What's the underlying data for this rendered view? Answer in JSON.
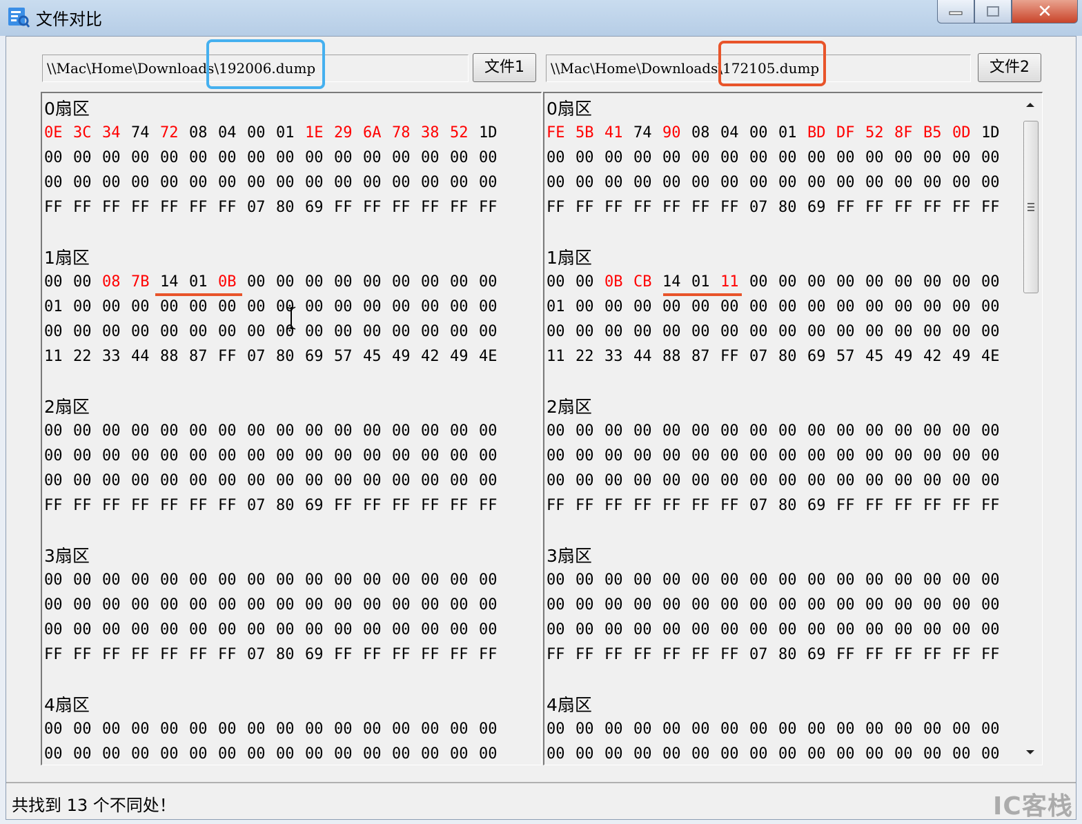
{
  "window": {
    "title": "文件对比",
    "controls": [
      "minimize",
      "maximize",
      "close"
    ],
    "close_glyph": "✕"
  },
  "left": {
    "path": "\\\\Mac\\Home\\Downloads\\192006.dump",
    "button_label": "文件1",
    "sectors": [
      {
        "title": "0扇区",
        "rows": [
          [
            "0E",
            "3C",
            "34",
            "74",
            "72",
            "08",
            "04",
            "00",
            "01",
            "1E",
            "29",
            "6A",
            "78",
            "38",
            "52",
            "1D"
          ],
          [
            "00",
            "00",
            "00",
            "00",
            "00",
            "00",
            "00",
            "00",
            "00",
            "00",
            "00",
            "00",
            "00",
            "00",
            "00",
            "00"
          ],
          [
            "00",
            "00",
            "00",
            "00",
            "00",
            "00",
            "00",
            "00",
            "00",
            "00",
            "00",
            "00",
            "00",
            "00",
            "00",
            "00"
          ],
          [
            "FF",
            "FF",
            "FF",
            "FF",
            "FF",
            "FF",
            "FF",
            "07",
            "80",
            "69",
            "FF",
            "FF",
            "FF",
            "FF",
            "FF",
            "FF"
          ]
        ],
        "diff": [
          [
            0,
            1,
            2,
            4,
            9,
            10,
            11,
            12,
            13,
            14
          ]
        ]
      },
      {
        "title": "1扇区",
        "rows": [
          [
            "00",
            "00",
            "08",
            "7B",
            "14",
            "01",
            "0B",
            "00",
            "00",
            "00",
            "00",
            "00",
            "00",
            "00",
            "00",
            "00"
          ],
          [
            "01",
            "00",
            "00",
            "00",
            "00",
            "00",
            "00",
            "00",
            "00",
            "00",
            "00",
            "00",
            "00",
            "00",
            "00",
            "00"
          ],
          [
            "00",
            "00",
            "00",
            "00",
            "00",
            "00",
            "00",
            "00",
            "00",
            "00",
            "00",
            "00",
            "00",
            "00",
            "00",
            "00"
          ],
          [
            "11",
            "22",
            "33",
            "44",
            "88",
            "87",
            "FF",
            "07",
            "80",
            "69",
            "57",
            "45",
            "49",
            "42",
            "49",
            "4E"
          ]
        ],
        "diff": [
          [
            2,
            3,
            6
          ]
        ]
      },
      {
        "title": "2扇区",
        "rows": [
          [
            "00",
            "00",
            "00",
            "00",
            "00",
            "00",
            "00",
            "00",
            "00",
            "00",
            "00",
            "00",
            "00",
            "00",
            "00",
            "00"
          ],
          [
            "00",
            "00",
            "00",
            "00",
            "00",
            "00",
            "00",
            "00",
            "00",
            "00",
            "00",
            "00",
            "00",
            "00",
            "00",
            "00"
          ],
          [
            "00",
            "00",
            "00",
            "00",
            "00",
            "00",
            "00",
            "00",
            "00",
            "00",
            "00",
            "00",
            "00",
            "00",
            "00",
            "00"
          ],
          [
            "FF",
            "FF",
            "FF",
            "FF",
            "FF",
            "FF",
            "FF",
            "07",
            "80",
            "69",
            "FF",
            "FF",
            "FF",
            "FF",
            "FF",
            "FF"
          ]
        ],
        "diff": []
      },
      {
        "title": "3扇区",
        "rows": [
          [
            "00",
            "00",
            "00",
            "00",
            "00",
            "00",
            "00",
            "00",
            "00",
            "00",
            "00",
            "00",
            "00",
            "00",
            "00",
            "00"
          ],
          [
            "00",
            "00",
            "00",
            "00",
            "00",
            "00",
            "00",
            "00",
            "00",
            "00",
            "00",
            "00",
            "00",
            "00",
            "00",
            "00"
          ],
          [
            "00",
            "00",
            "00",
            "00",
            "00",
            "00",
            "00",
            "00",
            "00",
            "00",
            "00",
            "00",
            "00",
            "00",
            "00",
            "00"
          ],
          [
            "FF",
            "FF",
            "FF",
            "FF",
            "FF",
            "FF",
            "FF",
            "07",
            "80",
            "69",
            "FF",
            "FF",
            "FF",
            "FF",
            "FF",
            "FF"
          ]
        ],
        "diff": []
      },
      {
        "title": "4扇区",
        "rows": [
          [
            "00",
            "00",
            "00",
            "00",
            "00",
            "00",
            "00",
            "00",
            "00",
            "00",
            "00",
            "00",
            "00",
            "00",
            "00",
            "00"
          ],
          [
            "00",
            "00",
            "00",
            "00",
            "00",
            "00",
            "00",
            "00",
            "00",
            "00",
            "00",
            "00",
            "00",
            "00",
            "00",
            "00"
          ]
        ],
        "diff": []
      }
    ]
  },
  "right": {
    "path": "\\\\Mac\\Home\\Downloads\\172105.dump",
    "button_label": "文件2",
    "sectors": [
      {
        "title": "0扇区",
        "rows": [
          [
            "FE",
            "5B",
            "41",
            "74",
            "90",
            "08",
            "04",
            "00",
            "01",
            "BD",
            "DF",
            "52",
            "8F",
            "B5",
            "0D",
            "1D"
          ],
          [
            "00",
            "00",
            "00",
            "00",
            "00",
            "00",
            "00",
            "00",
            "00",
            "00",
            "00",
            "00",
            "00",
            "00",
            "00",
            "00"
          ],
          [
            "00",
            "00",
            "00",
            "00",
            "00",
            "00",
            "00",
            "00",
            "00",
            "00",
            "00",
            "00",
            "00",
            "00",
            "00",
            "00"
          ],
          [
            "FF",
            "FF",
            "FF",
            "FF",
            "FF",
            "FF",
            "FF",
            "07",
            "80",
            "69",
            "FF",
            "FF",
            "FF",
            "FF",
            "FF",
            "FF"
          ]
        ],
        "diff": [
          [
            0,
            1,
            2,
            4,
            9,
            10,
            11,
            12,
            13,
            14
          ]
        ]
      },
      {
        "title": "1扇区",
        "rows": [
          [
            "00",
            "00",
            "0B",
            "CB",
            "14",
            "01",
            "11",
            "00",
            "00",
            "00",
            "00",
            "00",
            "00",
            "00",
            "00",
            "00"
          ],
          [
            "01",
            "00",
            "00",
            "00",
            "00",
            "00",
            "00",
            "00",
            "00",
            "00",
            "00",
            "00",
            "00",
            "00",
            "00",
            "00"
          ],
          [
            "00",
            "00",
            "00",
            "00",
            "00",
            "00",
            "00",
            "00",
            "00",
            "00",
            "00",
            "00",
            "00",
            "00",
            "00",
            "00"
          ],
          [
            "11",
            "22",
            "33",
            "44",
            "88",
            "87",
            "FF",
            "07",
            "80",
            "69",
            "57",
            "45",
            "49",
            "42",
            "49",
            "4E"
          ]
        ],
        "diff": [
          [
            2,
            3,
            6
          ]
        ]
      },
      {
        "title": "2扇区",
        "rows": [
          [
            "00",
            "00",
            "00",
            "00",
            "00",
            "00",
            "00",
            "00",
            "00",
            "00",
            "00",
            "00",
            "00",
            "00",
            "00",
            "00"
          ],
          [
            "00",
            "00",
            "00",
            "00",
            "00",
            "00",
            "00",
            "00",
            "00",
            "00",
            "00",
            "00",
            "00",
            "00",
            "00",
            "00"
          ],
          [
            "00",
            "00",
            "00",
            "00",
            "00",
            "00",
            "00",
            "00",
            "00",
            "00",
            "00",
            "00",
            "00",
            "00",
            "00",
            "00"
          ],
          [
            "FF",
            "FF",
            "FF",
            "FF",
            "FF",
            "FF",
            "FF",
            "07",
            "80",
            "69",
            "FF",
            "FF",
            "FF",
            "FF",
            "FF",
            "FF"
          ]
        ],
        "diff": []
      },
      {
        "title": "3扇区",
        "rows": [
          [
            "00",
            "00",
            "00",
            "00",
            "00",
            "00",
            "00",
            "00",
            "00",
            "00",
            "00",
            "00",
            "00",
            "00",
            "00",
            "00"
          ],
          [
            "00",
            "00",
            "00",
            "00",
            "00",
            "00",
            "00",
            "00",
            "00",
            "00",
            "00",
            "00",
            "00",
            "00",
            "00",
            "00"
          ],
          [
            "00",
            "00",
            "00",
            "00",
            "00",
            "00",
            "00",
            "00",
            "00",
            "00",
            "00",
            "00",
            "00",
            "00",
            "00",
            "00"
          ],
          [
            "FF",
            "FF",
            "FF",
            "FF",
            "FF",
            "FF",
            "FF",
            "07",
            "80",
            "69",
            "FF",
            "FF",
            "FF",
            "FF",
            "FF",
            "FF"
          ]
        ],
        "diff": []
      },
      {
        "title": "4扇区",
        "rows": [
          [
            "00",
            "00",
            "00",
            "00",
            "00",
            "00",
            "00",
            "00",
            "00",
            "00",
            "00",
            "00",
            "00",
            "00",
            "00",
            "00"
          ],
          [
            "00",
            "00",
            "00",
            "00",
            "00",
            "00",
            "00",
            "00",
            "00",
            "00",
            "00",
            "00",
            "00",
            "00",
            "00",
            "00"
          ]
        ],
        "diff": []
      }
    ]
  },
  "status": {
    "text": "共找到 13 个不同处！"
  },
  "watermark": {
    "text": "IC客栈"
  },
  "colors": {
    "diff_byte": "#ff0000",
    "highlight_left": "#45b0ef",
    "highlight_right": "#e8542a",
    "underline": "#e8542a"
  },
  "icons": {
    "app": "compare-document-icon",
    "scroll_up": "arrow-up-icon",
    "scroll_down": "arrow-down-icon",
    "cursor": "text-cursor-icon"
  }
}
